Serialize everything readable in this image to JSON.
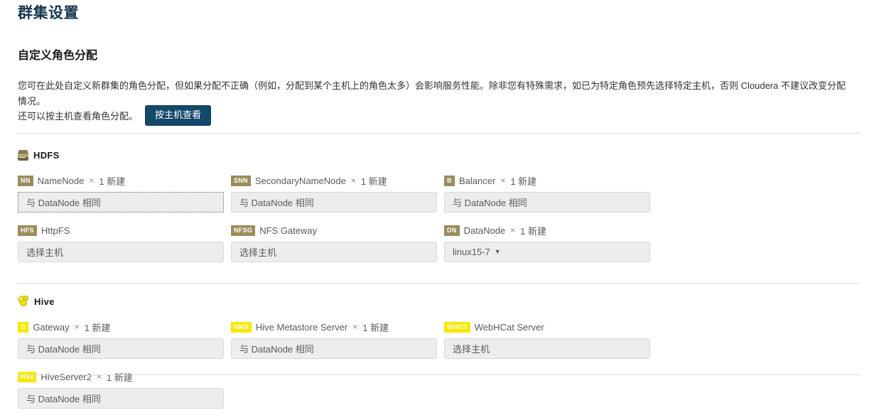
{
  "page": {
    "title": "群集设置",
    "section_title": "自定义角色分配",
    "intro": "您可在此处自定义新群集的角色分配，但如果分配不正确（例如，分配到某个主机上的角色太多）会影响服务性能。除非您有特殊需求，如已为特定角色预先选择特定主机，否则 Cloudera 不建议改变分配情况。",
    "host_view_line": "还可以按主机查看角色分配。",
    "host_view_button": "按主机查看"
  },
  "placeholders": {
    "same_as_datanode": "与 DataNode 相同",
    "select_host": "选择主机"
  },
  "colors": {
    "title": "#16384f",
    "button": "#14486b",
    "badge_hdfs": "#9a8c5c",
    "badge_hive": "#f7e800",
    "divider": "#dddddd",
    "host_box_bg": "#ededed"
  },
  "services": [
    {
      "name": "HDFS",
      "icon": "hdfs-icon",
      "roles": [
        {
          "badge": "NN",
          "name": "NameNode",
          "times": "×",
          "count": "1 新建",
          "host_value": "与 DataNode 相同",
          "focused": true,
          "caret": false
        },
        {
          "badge": "SNN",
          "name": "SecondaryNameNode",
          "times": "×",
          "count": "1 新建",
          "host_value": "与 DataNode 相同",
          "focused": false,
          "caret": false
        },
        {
          "badge": "B",
          "name": "Balancer",
          "times": "×",
          "count": "1 新建",
          "host_value": "与 DataNode 相同",
          "focused": false,
          "caret": false
        },
        {
          "badge": "HFS",
          "name": "HttpFS",
          "times": "",
          "count": "",
          "host_value": "选择主机",
          "focused": false,
          "caret": false
        },
        {
          "badge": "NFSG",
          "name": "NFS Gateway",
          "times": "",
          "count": "",
          "host_value": "选择主机",
          "focused": false,
          "caret": false
        },
        {
          "badge": "DN",
          "name": "DataNode",
          "times": "×",
          "count": "1 新建",
          "host_value": "linux15-7",
          "focused": false,
          "caret": true
        }
      ]
    },
    {
      "name": "Hive",
      "icon": "hive-icon",
      "roles": [
        {
          "badge": "G",
          "name": "Gateway",
          "times": "×",
          "count": "1 新建",
          "host_value": "与 DataNode 相同",
          "focused": false,
          "caret": false
        },
        {
          "badge": "HMS",
          "name": "Hive Metastore Server",
          "times": "×",
          "count": "1 新建",
          "host_value": "与 DataNode 相同",
          "focused": false,
          "caret": false
        },
        {
          "badge": "WHCS",
          "name": "WebHCat Server",
          "times": "",
          "count": "",
          "host_value": "选择主机",
          "focused": false,
          "caret": false
        },
        {
          "badge": "HS2",
          "name": "HiveServer2",
          "times": "×",
          "count": "1 新建",
          "host_value": "与 DataNode 相同",
          "focused": false,
          "caret": false
        }
      ]
    }
  ]
}
